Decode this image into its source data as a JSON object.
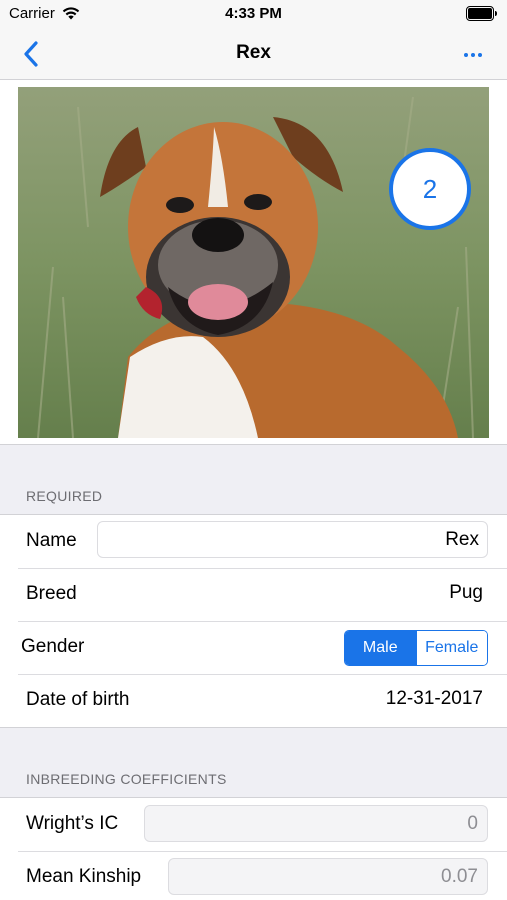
{
  "status_bar": {
    "carrier": "Carrier",
    "time": "4:33 PM"
  },
  "nav": {
    "title": "Rex",
    "back_icon": "chevron-left-icon",
    "more_icon": "ellipsis-icon",
    "accent_color": "#1a74e8"
  },
  "photo": {
    "count": "2"
  },
  "required": {
    "header": "REQUIRED",
    "name_label": "Name",
    "name_value": "Rex",
    "breed_label": "Breed",
    "breed_value": "Pug",
    "gender_label": "Gender",
    "gender_options": [
      "Male",
      "Female"
    ],
    "gender_selected": "Male",
    "dob_label": "Date of birth",
    "dob_value": "12-31-2017"
  },
  "inbreeding": {
    "header": "INBREEDING COEFFICIENTS",
    "wright_label": "Wright’s IC",
    "wright_value": "0",
    "kinship_label": "Mean Kinship",
    "kinship_value": "0.07"
  }
}
